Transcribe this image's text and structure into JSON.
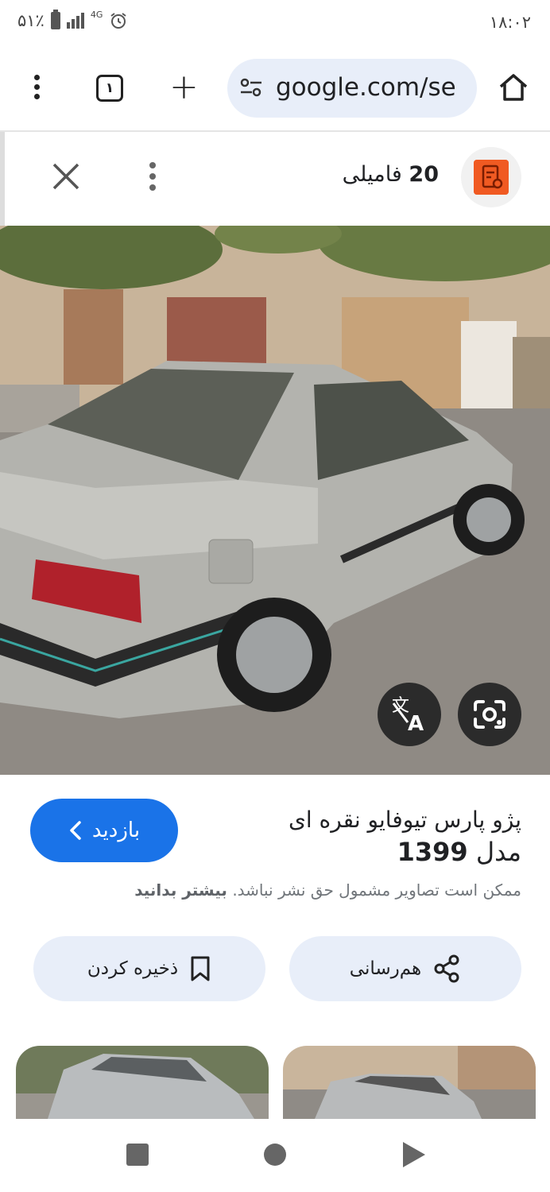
{
  "status_bar": {
    "battery": "۵۱٪",
    "network": "4G",
    "time": "۱۸:۰۲"
  },
  "browser": {
    "tab_count": "۱",
    "url": "google.com/se"
  },
  "lens_header": {
    "site_count": "20",
    "site_name": "فامیلی"
  },
  "result": {
    "title_line1": "پژو پارس تیوفایو نقره ای",
    "title_line2_prefix": "مدل",
    "title_line2_year": "1399",
    "visit_label": "بازدید",
    "notice_text": "ممکن است تصاویر مشمول حق نشر نباشد.",
    "notice_link": "بیشتر بدانید",
    "share_label": "هم‌رسانی",
    "save_label": "ذخیره کردن"
  },
  "colors": {
    "accent": "#1a73e8",
    "pill_bg": "#e8eef9",
    "site_logo": "#f05a22"
  },
  "icons": {
    "menu": "vertical-dots-icon",
    "home": "home-icon",
    "close": "close-icon",
    "translate": "translate-icon",
    "lens": "lens-search-icon",
    "share": "share-icon",
    "bookmark": "bookmark-icon"
  }
}
